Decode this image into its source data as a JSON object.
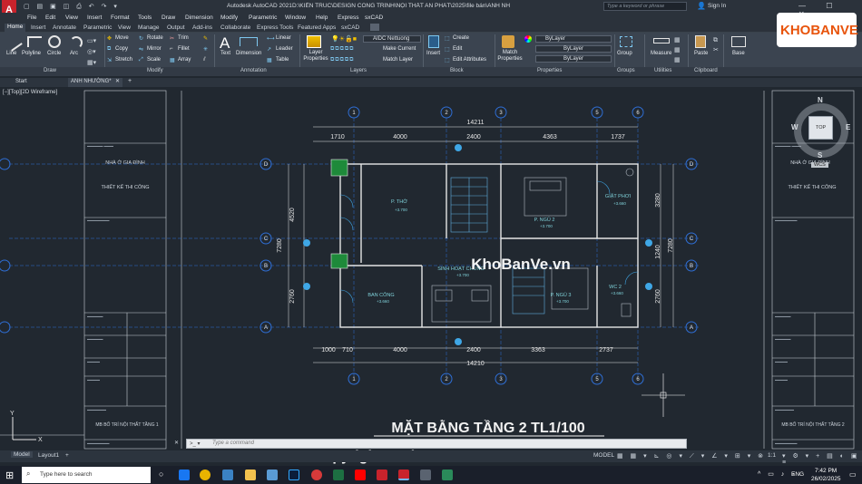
{
  "app": {
    "title": "Autodesk AutoCAD 2021",
    "file_path": "D:\\KIẾN TRÚC\\DESIGN CÔNG TRÌNH\\NỘI THẤT AN PHÁT\\2025\\file bán\\ANH NHƯỜNG.dwg",
    "search_placeholder": "Type a keyword or phrase",
    "sign_in": "Sign In"
  },
  "menu": [
    "File",
    "Edit",
    "View",
    "Insert",
    "Format",
    "Tools",
    "Draw",
    "Dimension",
    "Modify",
    "Parametric",
    "Window",
    "Help",
    "Express",
    "sxCAD"
  ],
  "ribbon_tabs": [
    "Home",
    "Insert",
    "Annotate",
    "Parametric",
    "View",
    "Manage",
    "Output",
    "Add-ins",
    "Collaborate",
    "Express Tools",
    "Featured Apps",
    "sxCAD"
  ],
  "draw_tools": [
    "Line",
    "Polyline",
    "Circle",
    "Arc"
  ],
  "modify_tools": [
    "Move",
    "Rotate",
    "Trim",
    "Copy",
    "Mirror",
    "Fillet",
    "Stretch",
    "Scale",
    "Array"
  ],
  "annotation_tools": {
    "text": "Text",
    "dimension": "Dimension",
    "linear": "Linear",
    "leader": "Leader",
    "table": "Table"
  },
  "layers": {
    "current": "AIDC Nettuong",
    "properties": "Layer Properties",
    "make_current": "Make Current",
    "match_layer": "Match Layer"
  },
  "block": {
    "insert": "Insert",
    "create": "Create",
    "edit": "Edit",
    "edit_attributes": "Edit Attributes"
  },
  "properties": {
    "match": "Match Properties",
    "color": "ByLayer",
    "linetype": "ByLayer",
    "lineweight": "ByLayer"
  },
  "group": {
    "label": "Group"
  },
  "utilities": {
    "measure": "Measure"
  },
  "clipboard": {
    "paste": "Paste"
  },
  "view": {
    "base": "Base"
  },
  "panel_labels": [
    "Draw",
    "Modify",
    "Annotation",
    "Layers",
    "Block",
    "Properties",
    "Groups",
    "Utilities",
    "Clipboard"
  ],
  "doc_tabs": {
    "start": "Start",
    "current": "ANH NHƯỜNG*"
  },
  "viewport_label": "[−][Top][2D Wireframe]",
  "drawing": {
    "title": "MẶT BẰNG TẦNG 2 TL1/100",
    "top_total": "14211",
    "bottom_total": "14210",
    "top_dims": [
      "1710",
      "4000",
      "2400",
      "4363",
      "1737"
    ],
    "bottom_dims": [
      "1000",
      "710",
      "4000",
      "2400",
      "3363",
      "2737"
    ],
    "left_dims": [
      "4520",
      "7280",
      "2760"
    ],
    "right_dims": [
      "3280",
      "1240",
      "2760",
      "7280"
    ],
    "axes_numbers": [
      "1",
      "2",
      "3",
      "5",
      "6"
    ],
    "axes_letters": [
      "D",
      "C",
      "B",
      "A"
    ],
    "rooms": [
      {
        "name": "P. THỜ",
        "level": "+3.700"
      },
      {
        "name": "P. NGỦ 2",
        "level": "+3.700"
      },
      {
        "name": "GIẶT PHƠI",
        "level": "+3.660"
      },
      {
        "name": "SINH HOẠT CHUNG",
        "level": "+3.700"
      },
      {
        "name": "BAN CÔNG",
        "level": "+3.660"
      },
      {
        "name": "P. NGỦ 3",
        "level": "+3.700"
      },
      {
        "name": "WC 2",
        "level": "+3.660"
      }
    ],
    "left_sheet": {
      "project": "NHÀ Ở GIA ĐÌNH",
      "stage": "THIẾT KẾ THI CÔNG",
      "sheet": "MB BỐ TRÍ NỘI THẤT TẦNG 1"
    },
    "right_sheet": {
      "project": "NHÀ Ở GIA ĐÌNH",
      "stage": "THIẾT KẾ THI CÔNG",
      "sheet": "MB BỐ TRÍ NỘI THẤT TẦNG 2"
    }
  },
  "watermark": {
    "center": "KhoBanVe.vn",
    "copyright": "Copyright © KhoBanVe.vn",
    "logo": "KHOBANVE"
  },
  "viewcube": {
    "n": "N",
    "s": "S",
    "e": "E",
    "w": "W",
    "top": "TOP",
    "wcs": "WCS"
  },
  "command_placeholder": "Type a command",
  "layout_tabs": [
    "Model",
    "Layout1"
  ],
  "status": {
    "model": "MODEL",
    "scale": "1:1"
  },
  "taskbar": {
    "search": "Type here to search",
    "lang": "ENG",
    "time": "7:42 PM",
    "date": "26/02/2025"
  },
  "colors": {
    "accent": "#1e90ff",
    "autocad_red": "#c8232c",
    "room_label": "#7fd1d9",
    "dim": "#e6e6e6",
    "axis": "#2f6fd6"
  }
}
